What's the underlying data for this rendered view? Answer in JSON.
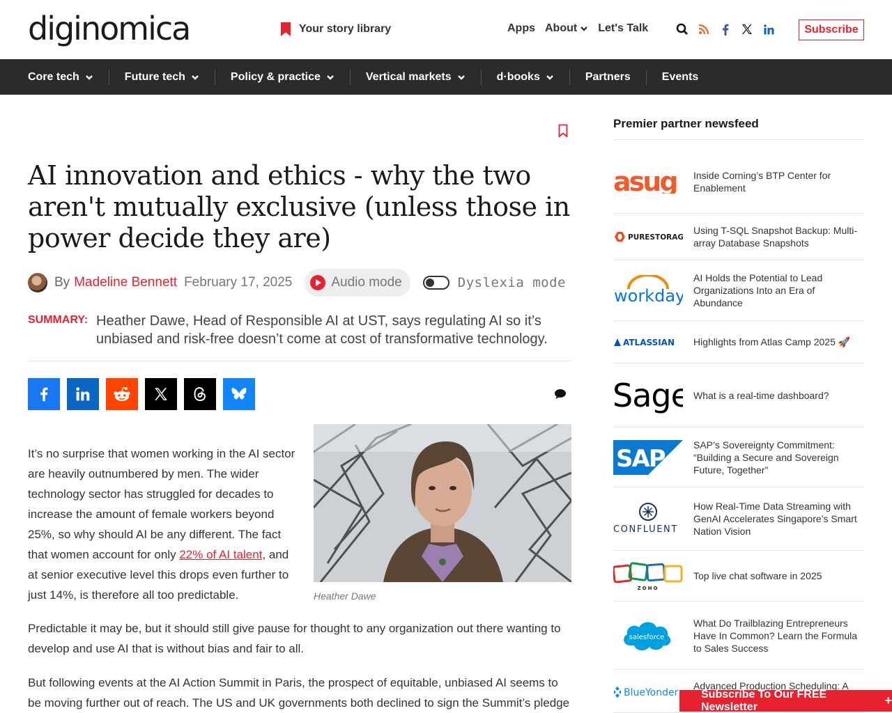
{
  "header": {
    "logo": "diginomica",
    "story_library": "Your story library",
    "nav": [
      "Apps",
      "About",
      "Let's Talk"
    ],
    "subscribe": "Subscribe"
  },
  "mainnav": [
    {
      "label": "Core tech"
    },
    {
      "label": "Future tech"
    },
    {
      "label": "Policy & practice"
    },
    {
      "label": "Vertical markets"
    },
    {
      "label": "d·books"
    },
    {
      "label": "Partners"
    },
    {
      "label": "Events"
    }
  ],
  "article": {
    "title": "AI innovation and ethics - why the two aren't mutually exclusive (unless those in power decide they are)",
    "by": "By",
    "author": "Madeline Bennett",
    "date": "February 17, 2025",
    "audio_mode": "Audio mode",
    "dyslexia_mode": "Dyslexia mode",
    "summary_label": "SUMMARY:",
    "summary": "Heather Dawe, Head of Responsible AI at UST, says regulating AI so it’s unbiased and risk-free doesn’t come at cost of transformative technology.",
    "caption": "Heather Dawe",
    "p1_a": "It’s no surprise that women working in the AI sector are heavily outnumbered by men. The wider technology sector has struggled for decades to increase the amount of female workers beyond 25%, so why should AI be any different. The fact that women account for only ",
    "p1_link": "22% of AI talent",
    "p1_b": ", and at senior executive level this drops even further to just 14%, is therefore all too predictable.",
    "p2": "Predictable it may be, but it should still give pause for thought to any organization out there wanting to develop and use AI that is without bias and fair to all.",
    "p3": "But following events at the AI Action Summit in Paris, the prospect of equitable, unbiased AI seems to be moving further out of reach. The US and UK governments both declined to sign the Summit’s pledge"
  },
  "sidebar": {
    "title": "Premier partner newsfeed",
    "items": [
      {
        "logo": "asug",
        "title": "Inside Corning’s BTP Center for Enablement"
      },
      {
        "logo": "PURESTORAGE",
        "title": "Using T-SQL Snapshot Backup: Multi-array Database Snapshots"
      },
      {
        "logo": "workday.",
        "title": "AI Holds the Potential to Lead Organizations Into an Era of Abundance"
      },
      {
        "logo": "ATLASSIAN",
        "title": "Highlights from Atlas Camp 2025 🚀"
      },
      {
        "logo": "Sage",
        "title": "What is a real-time dashboard?"
      },
      {
        "logo": "SAP",
        "title": "SAP’s Sovereignty Commitment: “Building a Secure and Sovereign Future, Together”"
      },
      {
        "logo": "CONFLUENT",
        "title": "How Real-Time Data Streaming with GenAI Accelerates Singapore’s Smart Nation Vision"
      },
      {
        "logo": "ZOHO",
        "title": "Top live chat software in 2025"
      },
      {
        "logo": "salesforce",
        "title": "What Do Trailblazing Entrepreneurs Have In Common? Learn the Formula to Sales Success"
      },
      {
        "logo": "BlueYonder",
        "title": "Advanced Production Scheduling: A"
      }
    ]
  },
  "newsletter": "Subscribe To Our FREE Newsletter",
  "colors": {
    "accent": "#e8212f",
    "nav_bg": "#2b2b2b"
  }
}
